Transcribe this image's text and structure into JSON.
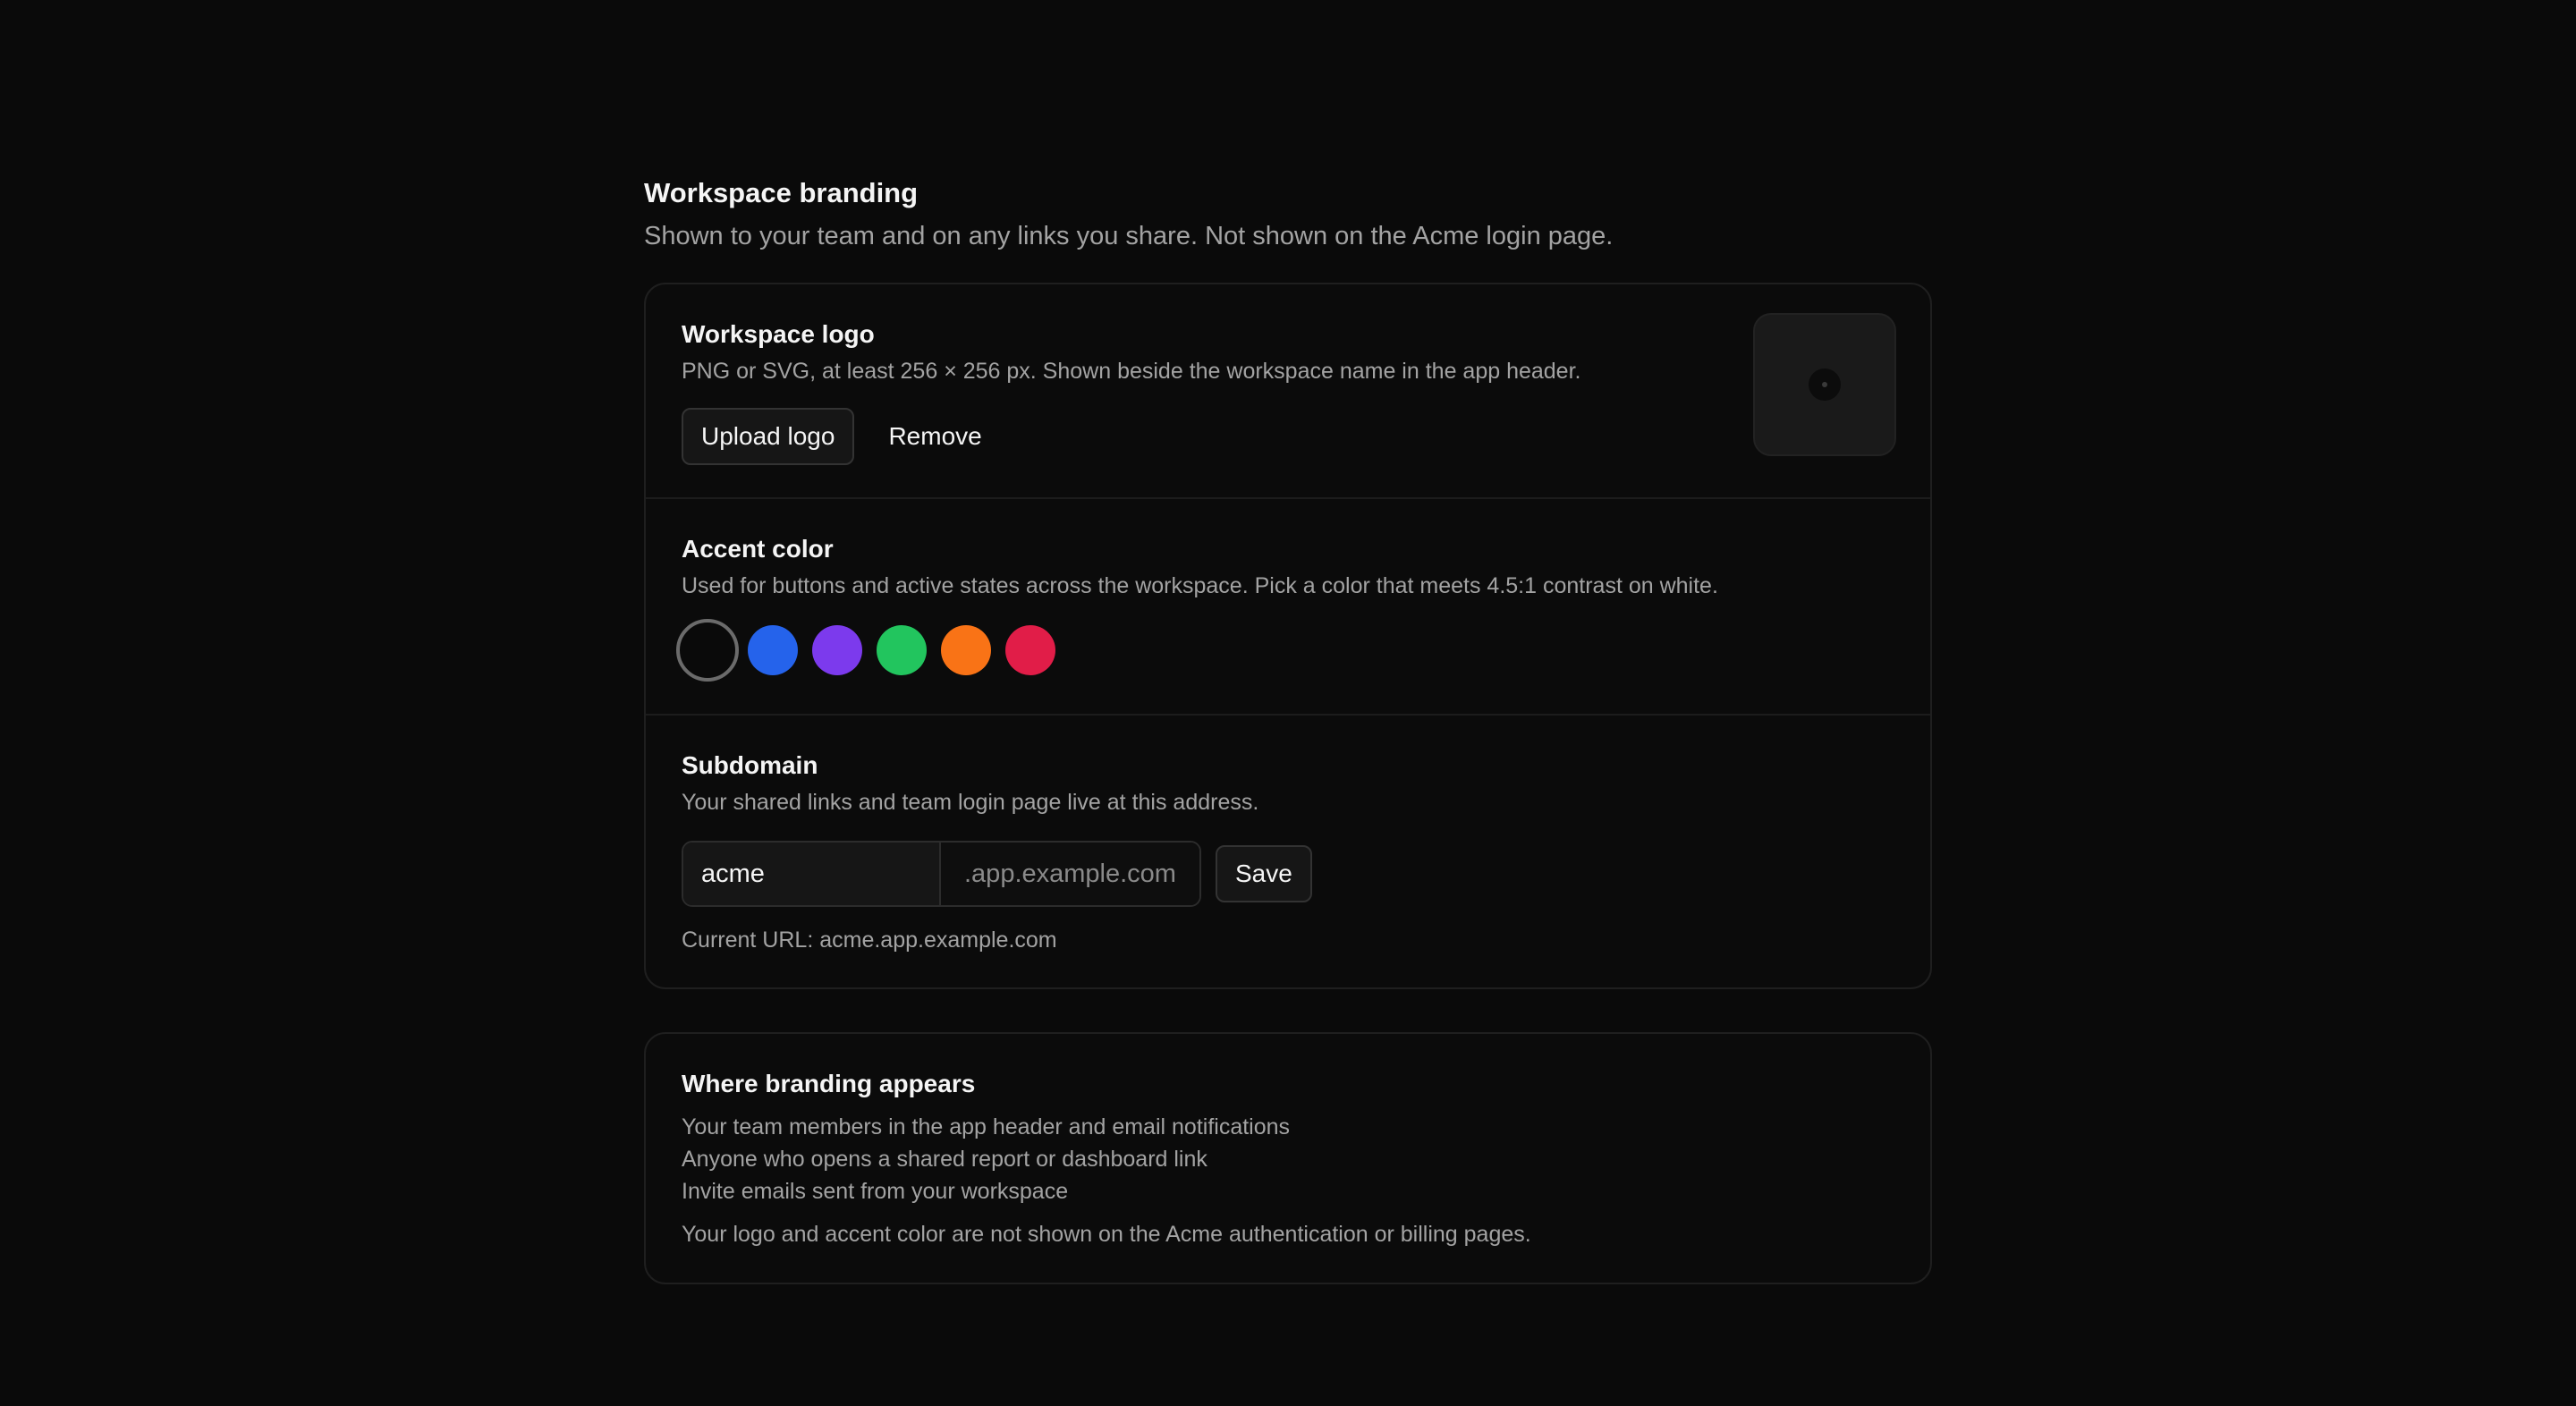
{
  "header": {
    "title": "Workspace branding",
    "subtitle": "Shown to your team and on any links you share. Not shown on the Acme login page."
  },
  "logo_section": {
    "title": "Workspace logo",
    "description": "PNG or SVG, at least 256 × 256 px. Shown beside the workspace name in the app header.",
    "upload_label": "Upload logo",
    "remove_label": "Remove"
  },
  "accent_section": {
    "title": "Accent color",
    "description": "Used for buttons and active states across the workspace. Pick a color that meets 4.5:1 contrast on white.",
    "swatches": [
      {
        "name": "black",
        "color": "#0a0a0a",
        "selected": true
      },
      {
        "name": "blue",
        "color": "#2563eb",
        "selected": false
      },
      {
        "name": "purple",
        "color": "#7c3aed",
        "selected": false
      },
      {
        "name": "green",
        "color": "#22c55e",
        "selected": false
      },
      {
        "name": "orange",
        "color": "#f97316",
        "selected": false
      },
      {
        "name": "red",
        "color": "#e11d48",
        "selected": false
      }
    ]
  },
  "subdomain_section": {
    "title": "Subdomain",
    "description": "Your shared links and team login page live at this address.",
    "input_value": "acme",
    "suffix": ".app.example.com",
    "save_label": "Save",
    "current_url": "Current URL: acme.app.example.com"
  },
  "appears_card": {
    "title": "Where branding appears",
    "items": [
      "Your team members in the app header and email notifications",
      "Anyone who opens a shared report or dashboard link",
      "Invite emails sent from your workspace"
    ],
    "footnote": "Your logo and accent color are not shown on the Acme authentication or billing pages."
  }
}
